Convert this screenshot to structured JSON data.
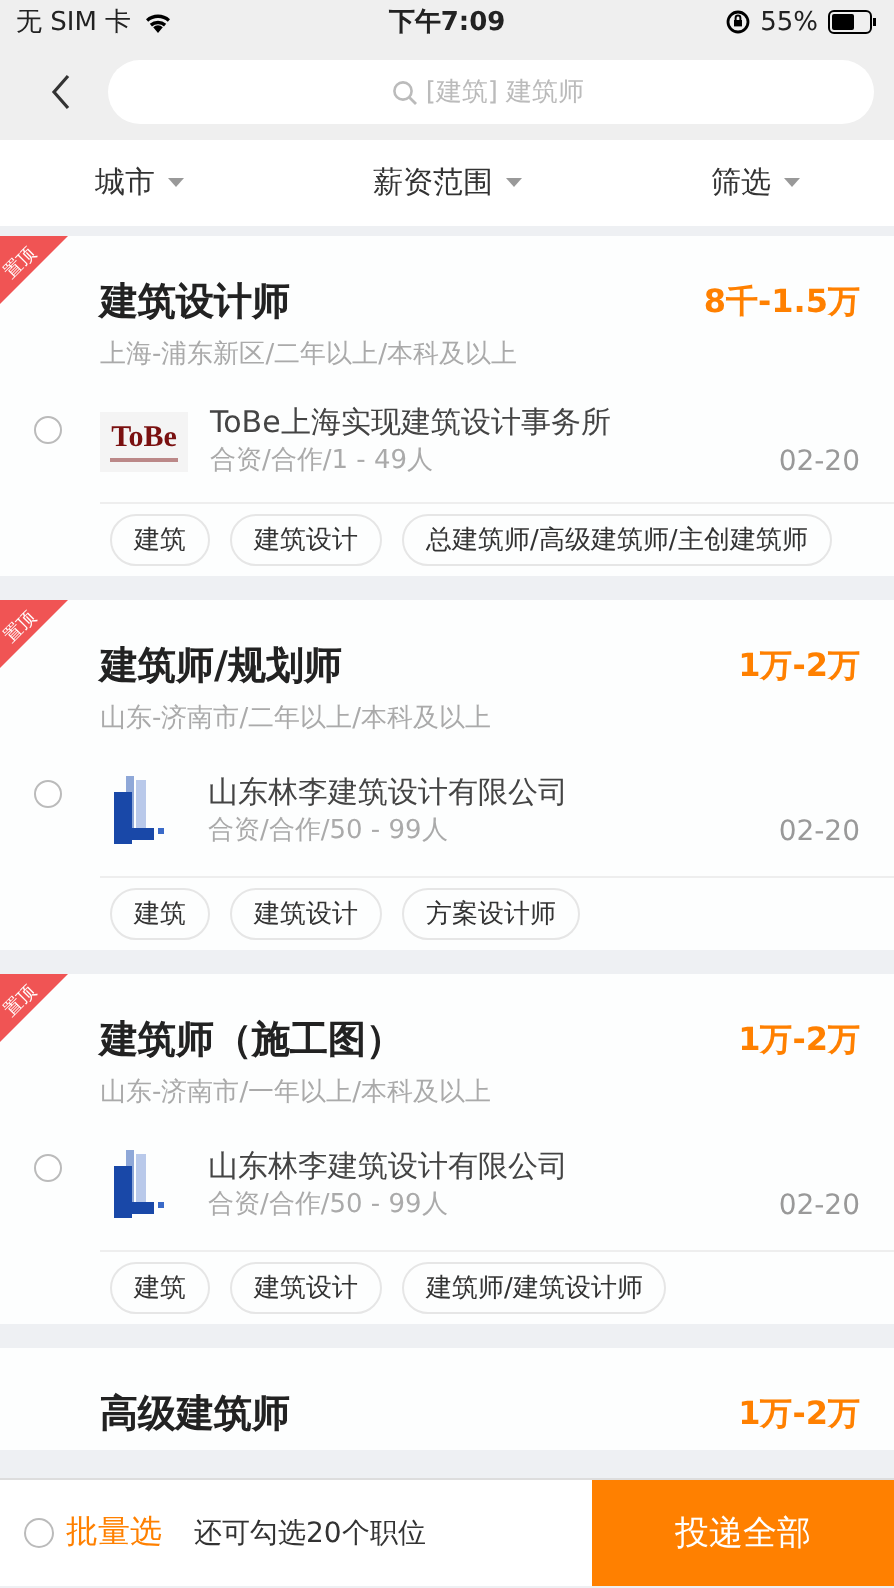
{
  "status_bar": {
    "carrier": "无 SIM 卡",
    "time": "下午7:09",
    "battery": "55%"
  },
  "search": {
    "placeholder": "[建筑] 建筑师"
  },
  "filters": [
    {
      "label": "城市"
    },
    {
      "label": "薪资范围"
    },
    {
      "label": "筛选"
    }
  ],
  "jobs": [
    {
      "pinned": true,
      "pin_label": "置顶",
      "title": "建筑设计师",
      "salary": "8千-1.5万",
      "details": "上海-浦东新区/二年以上/本科及以上",
      "selected": false,
      "company": {
        "logo": {
          "kind": "text",
          "text": "ToBe"
        },
        "name": "ToBe上海实现建筑设计事务所",
        "info": "合资/合作/1 - 49人"
      },
      "date": "02-20",
      "tags": [
        "建筑",
        "建筑设计",
        "总建筑师/高级建筑师/主创建筑师"
      ]
    },
    {
      "pinned": true,
      "pin_label": "置顶",
      "title": "建筑师/规划师",
      "salary": "1万-2万",
      "details": "山东-济南市/二年以上/本科及以上",
      "selected": false,
      "company": {
        "logo": {
          "kind": "blocks"
        },
        "name": "山东林李建筑设计有限公司",
        "info": "合资/合作/50 - 99人"
      },
      "date": "02-20",
      "tags": [
        "建筑",
        "建筑设计",
        "方案设计师"
      ]
    },
    {
      "pinned": true,
      "pin_label": "置顶",
      "title": "建筑师（施工图）",
      "salary": "1万-2万",
      "details": "山东-济南市/一年以上/本科及以上",
      "selected": false,
      "company": {
        "logo": {
          "kind": "blocks"
        },
        "name": "山东林李建筑设计有限公司",
        "info": "合资/合作/50 - 99人"
      },
      "date": "02-20",
      "tags": [
        "建筑",
        "建筑设计",
        "建筑师/建筑设计师"
      ]
    },
    {
      "pinned": false,
      "title": "高级建筑师",
      "salary": "1万-2万"
    }
  ],
  "bottom_bar": {
    "batch_label": "批量选",
    "batch_selected": false,
    "hint": "还可勾选20个职位",
    "submit": "投递全部"
  }
}
